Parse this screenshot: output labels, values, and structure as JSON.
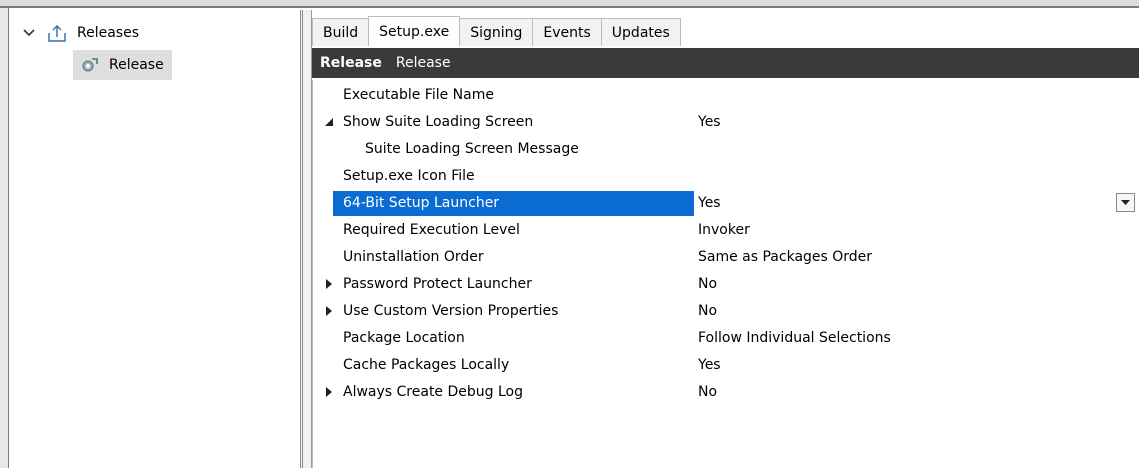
{
  "tree": {
    "root_label": "Releases",
    "child_label": "Release"
  },
  "tabs": [
    {
      "label": "Build"
    },
    {
      "label": "Setup.exe"
    },
    {
      "label": "Signing"
    },
    {
      "label": "Events"
    },
    {
      "label": "Updates"
    }
  ],
  "header": {
    "bold": "Release",
    "normal": "Release"
  },
  "properties": [
    {
      "name": "Executable File Name",
      "value": ""
    },
    {
      "name": "Show Suite Loading Screen",
      "value": "Yes"
    },
    {
      "name": "Suite Loading Screen Message",
      "value": ""
    },
    {
      "name": "Setup.exe Icon File",
      "value": ""
    },
    {
      "name": "64-Bit Setup Launcher",
      "value": "Yes"
    },
    {
      "name": "Required Execution Level",
      "value": "Invoker"
    },
    {
      "name": "Uninstallation Order",
      "value": "Same as Packages Order"
    },
    {
      "name": "Password Protect Launcher",
      "value": "No"
    },
    {
      "name": "Use Custom Version Properties",
      "value": "No"
    },
    {
      "name": "Package Location",
      "value": "Follow Individual Selections"
    },
    {
      "name": "Cache Packages Locally",
      "value": "Yes"
    },
    {
      "name": "Always Create Debug Log",
      "value": "No"
    }
  ],
  "colors": {
    "selection": "#0a6bd1",
    "header_bg": "#3a3a3a"
  }
}
